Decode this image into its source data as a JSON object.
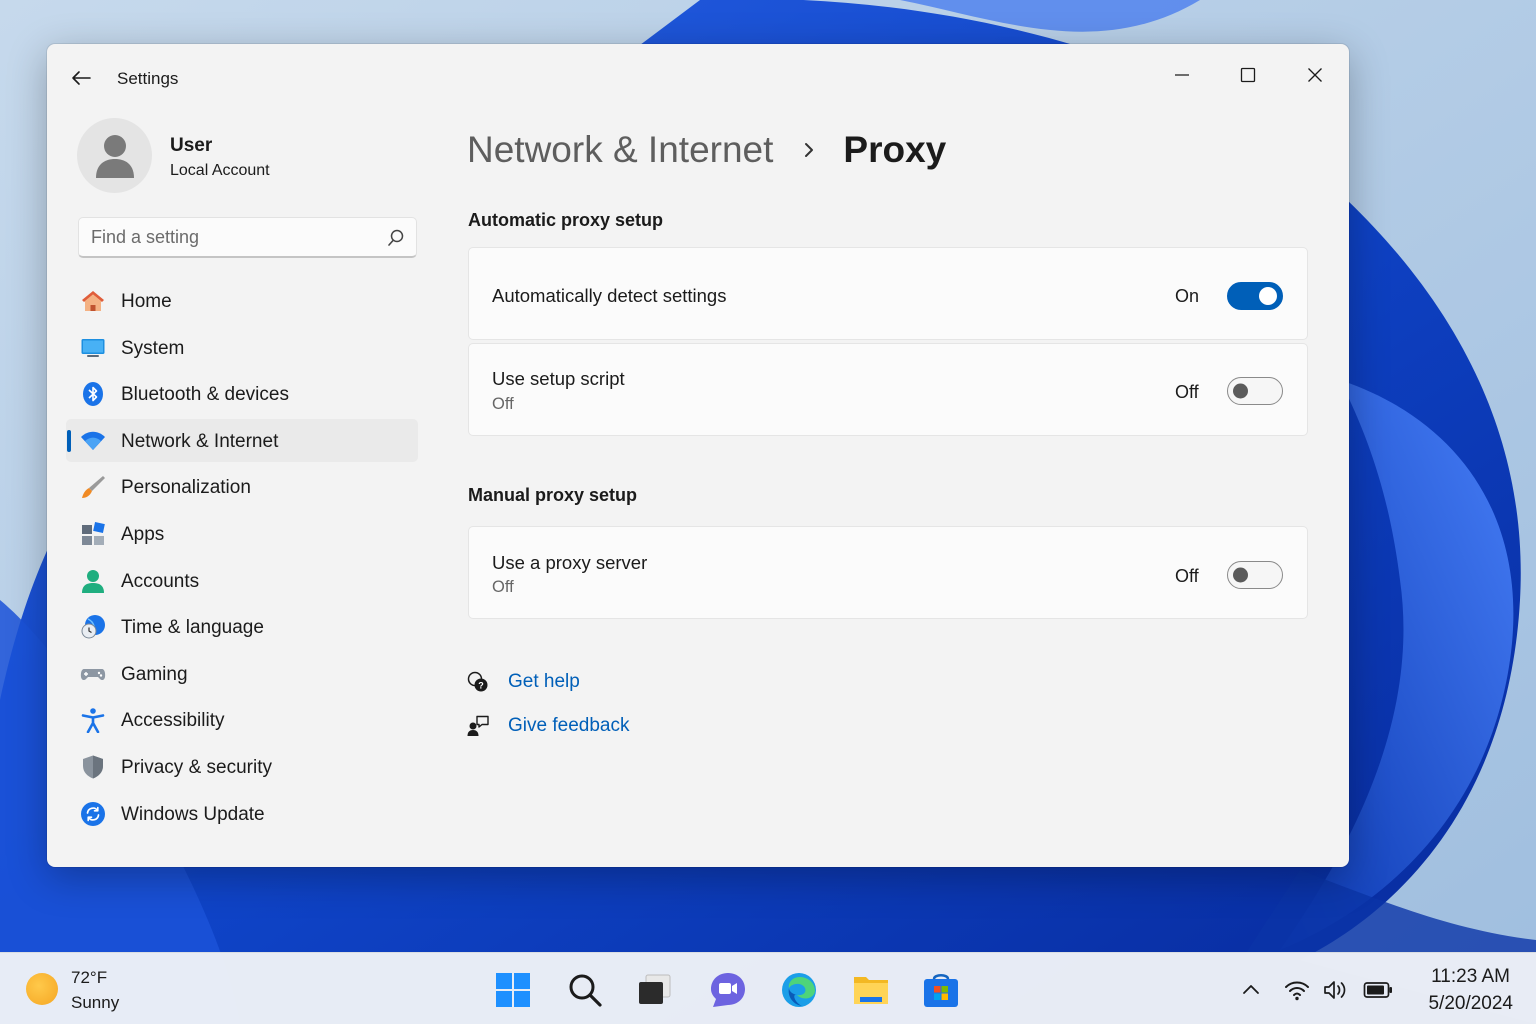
{
  "window": {
    "title": "Settings",
    "controls": {
      "minimize": "minimize-icon",
      "maximize": "maximize-icon",
      "close": "close-icon"
    }
  },
  "profile": {
    "name": "User",
    "account": "Local Account"
  },
  "search": {
    "placeholder": "Find a setting",
    "value": ""
  },
  "nav": {
    "items": [
      {
        "label": "Home",
        "icon": "home-icon"
      },
      {
        "label": "System",
        "icon": "system-icon"
      },
      {
        "label": "Bluetooth & devices",
        "icon": "bluetooth-icon"
      },
      {
        "label": "Network & Internet",
        "icon": "wifi-icon",
        "selected": true
      },
      {
        "label": "Personalization",
        "icon": "brush-icon"
      },
      {
        "label": "Apps",
        "icon": "apps-icon"
      },
      {
        "label": "Accounts",
        "icon": "accounts-icon"
      },
      {
        "label": "Time & language",
        "icon": "clock-globe-icon"
      },
      {
        "label": "Gaming",
        "icon": "gamepad-icon"
      },
      {
        "label": "Accessibility",
        "icon": "accessibility-icon"
      },
      {
        "label": "Privacy & security",
        "icon": "shield-icon"
      },
      {
        "label": "Windows Update",
        "icon": "update-icon"
      }
    ]
  },
  "breadcrumb": {
    "parent": "Network & Internet",
    "current": "Proxy"
  },
  "automatic": {
    "title": "Automatic proxy setup",
    "detect": {
      "title": "Automatically detect settings",
      "state": "On",
      "enabled": true
    },
    "script": {
      "title": "Use setup script",
      "subtitle": "Off",
      "state": "Off",
      "enabled": false
    }
  },
  "manual": {
    "title": "Manual proxy setup",
    "proxy": {
      "title": "Use a proxy server",
      "subtitle": "Off",
      "state": "Off",
      "enabled": false
    }
  },
  "links": {
    "help": "Get help",
    "feedback": "Give feedback"
  },
  "colors": {
    "accent": "#005fb8",
    "window_bg": "#f3f3f3",
    "card_bg": "#fbfbfb"
  },
  "taskbar": {
    "weather": {
      "temp": "72°F",
      "condition": "Sunny",
      "icon": "sun-icon"
    },
    "apps": [
      "start-icon",
      "search-icon",
      "task-view-icon",
      "teams-chat-icon",
      "edge-icon",
      "file-explorer-icon",
      "store-icon"
    ],
    "tray": [
      "chevron-up-icon",
      "wifi-icon",
      "volume-icon",
      "battery-icon"
    ],
    "time": "11:23 AM",
    "date": "5/20/2024"
  }
}
